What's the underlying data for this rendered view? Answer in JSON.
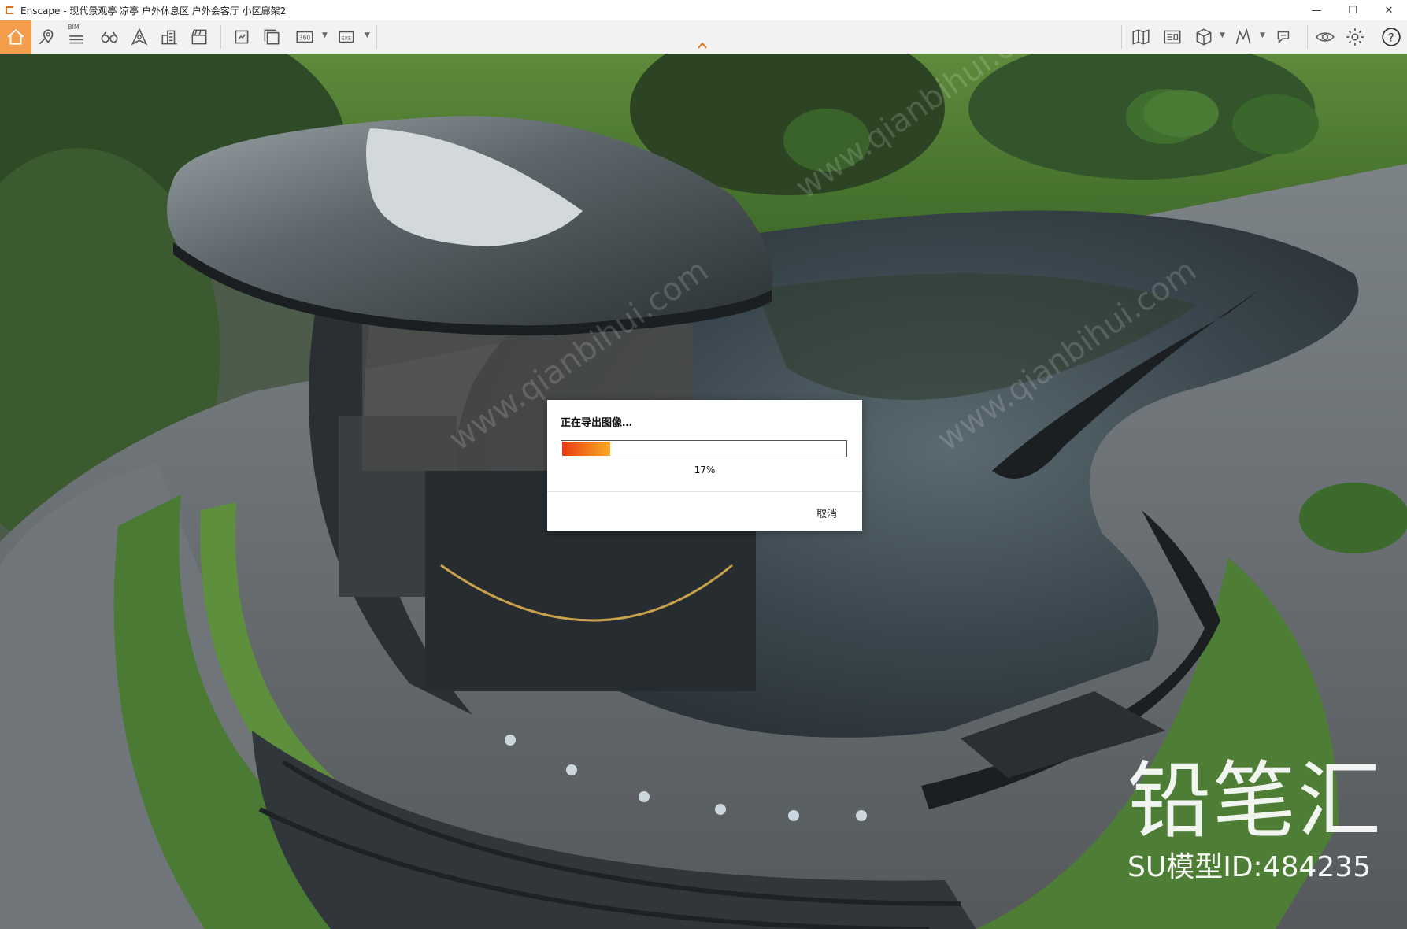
{
  "window": {
    "title": "Enscape - 现代景观亭 凉亭 户外休息区 户外会客厅 小区廊架2",
    "minimize_glyph": "—",
    "maximize_glyph": "☐",
    "close_glyph": "✕"
  },
  "toolbar": {
    "bim_label": "BIM",
    "items": [
      "home-icon",
      "location-pin-icon",
      "bim-list-icon",
      "binoculars-icon",
      "navigation-icon",
      "buildings-icon",
      "clapperboard-icon",
      "screenshot-icon",
      "batch-render-icon",
      "panorama-360-icon",
      "export-exe-icon",
      "map-icon",
      "asset-library-icon",
      "cube-icon",
      "sun-icon",
      "collaboration-icon",
      "eye-icon",
      "settings-gear-icon",
      "help-icon"
    ],
    "help_glyph": "?",
    "accent_color": "#f39c4a"
  },
  "dialog": {
    "title": "正在导出图像…",
    "progress": 0.17,
    "progress_label": "17%",
    "cancel_label": "取消"
  },
  "watermark": {
    "brand": "铅笔汇",
    "model_id": "SU模型ID:484235",
    "diagonal_text": "www.qianbihui.com"
  }
}
